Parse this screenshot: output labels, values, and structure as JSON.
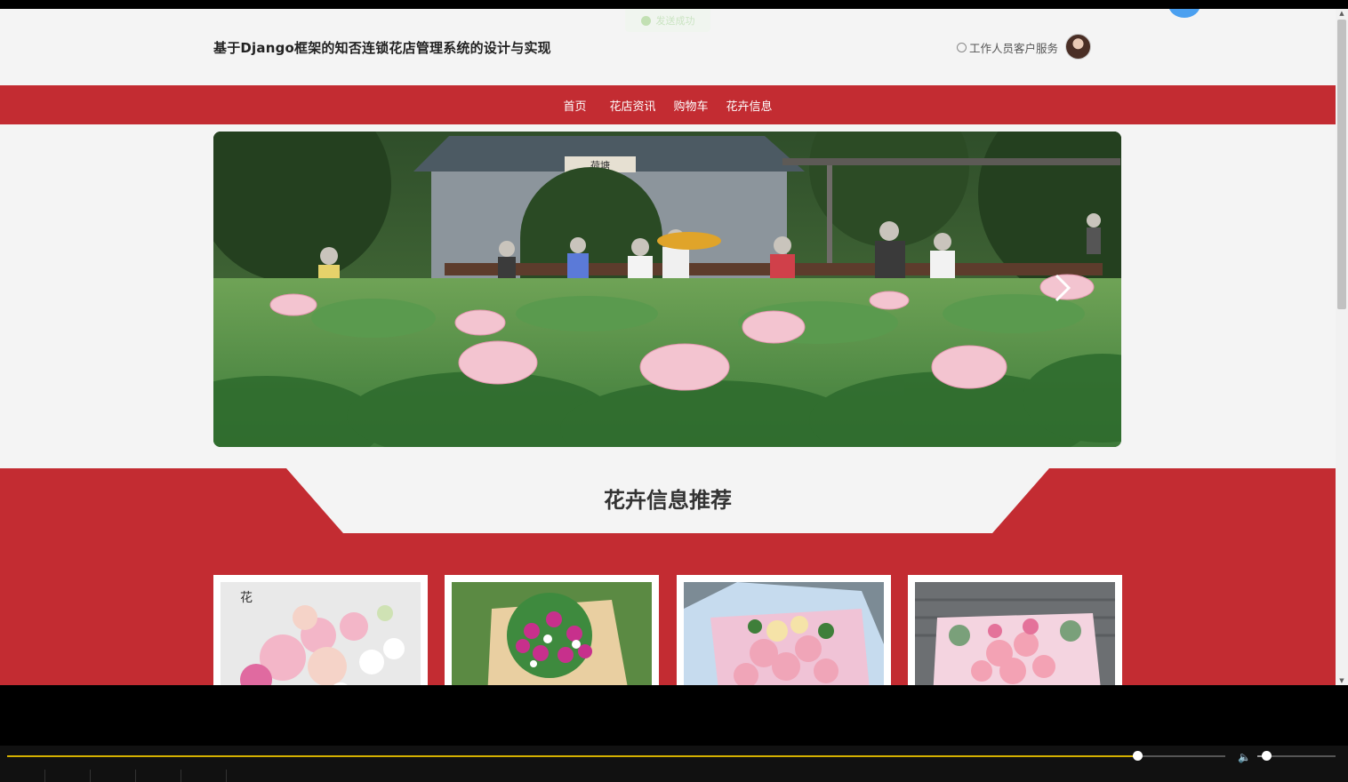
{
  "header": {
    "site_title": "基于Django框架的知否连锁花店管理系统的设计与实现",
    "customer_service_label": "工作人员客户服务"
  },
  "toast": {
    "message": "发送成功"
  },
  "nav": {
    "items": [
      {
        "label": "首页"
      },
      {
        "label": "花店资讯"
      },
      {
        "label": "购物车"
      },
      {
        "label": "花卉信息"
      }
    ]
  },
  "banner": {
    "gate_plaque": "荷塘",
    "next_icon": "chevron-right-icon"
  },
  "section": {
    "title": "花卉信息推荐"
  },
  "cards": [
    {
      "name": "card-1"
    },
    {
      "name": "card-2"
    },
    {
      "name": "card-3"
    },
    {
      "name": "card-4"
    }
  ],
  "player": {
    "progress": 0.928,
    "volume": 0.11,
    "volume_icon": "speaker-icon"
  },
  "colors": {
    "brand_red": "#c32c32",
    "page_bg": "#f4f4f4",
    "progress_fill": "#d4b000"
  }
}
